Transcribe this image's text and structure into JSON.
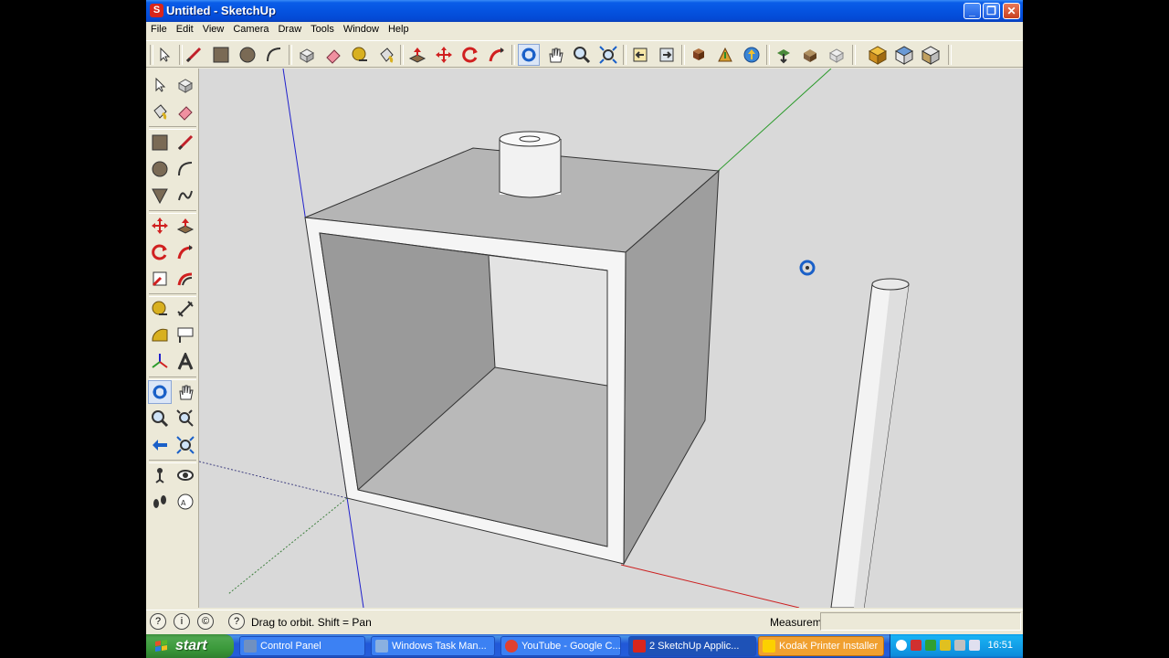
{
  "window": {
    "title": "Untitled - SketchUp",
    "controls": [
      "minimize",
      "maximize",
      "close"
    ]
  },
  "menu": [
    "File",
    "Edit",
    "View",
    "Camera",
    "Draw",
    "Tools",
    "Window",
    "Help"
  ],
  "toolbar_icons": [
    "select-icon",
    "line-icon",
    "rectangle-icon",
    "circle-icon",
    "arc-icon",
    "make-component-icon",
    "eraser-icon",
    "tape-measure-icon",
    "paint-bucket-icon",
    "push-pull-icon",
    "move-icon",
    "rotate-icon",
    "follow-me-icon",
    "orbit-icon",
    "pan-icon",
    "zoom-icon",
    "zoom-extents-icon",
    "previous-view-icon",
    "next-view-icon",
    "place-model-icon",
    "get-models-icon",
    "share-model-icon",
    "get-current-view-icon",
    "toggle-terrain-icon",
    "add-location-icon",
    "iso-view-icon",
    "top-view-icon",
    "front-view-icon"
  ],
  "status": {
    "hint": "Drag to orbit.  Shift = Pan",
    "measurements_label": "Measurements",
    "measurements_value": ""
  },
  "taskbar": {
    "start_label": "start",
    "tasks": [
      {
        "label": "Control Panel"
      },
      {
        "label": "Windows Task Man..."
      },
      {
        "label": "YouTube - Google C..."
      },
      {
        "label": "2 SketchUp Applic..."
      },
      {
        "label": "Kodak Printer Installer"
      }
    ],
    "clock": "16:51"
  },
  "colors": {
    "title_blue": "#0553e0",
    "start_green": "#3b9a3b",
    "viewport_bg": "#d9d9d9",
    "red_axis": "#cc2020",
    "green_axis": "#2a9a2a",
    "blue_axis": "#2020cc"
  }
}
